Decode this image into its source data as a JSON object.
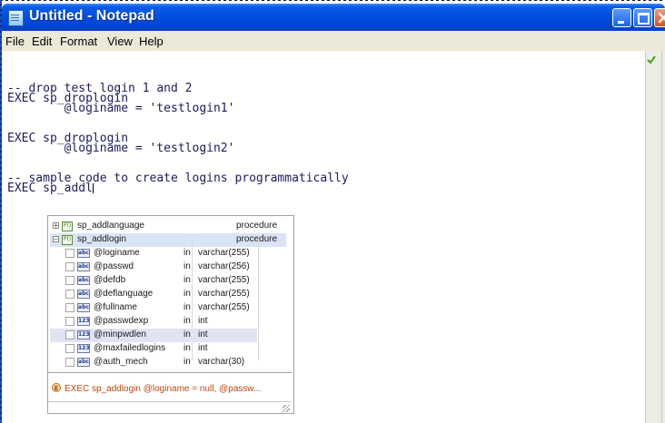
{
  "window": {
    "title": "Untitled - Notepad"
  },
  "menu": [
    "File",
    "Edit",
    "Format",
    "View",
    "Help"
  ],
  "editor": {
    "lines": [
      "",
      "-- drop test login 1 and 2",
      "EXEC sp_droplogin",
      "        @loginame = 'testlogin1'",
      "",
      "",
      "EXEC sp_droplogin",
      "        @loginame = 'testlogin2'",
      "",
      "",
      "-- sample code to create logins programmatically",
      "EXEC sp_addl"
    ]
  },
  "intellisense": {
    "items": [
      {
        "name": "sp_addlanguage",
        "kind": "procedure",
        "expander": "+",
        "icon": "P()"
      },
      {
        "name": "sp_addlogin",
        "kind": "procedure",
        "expander": "−",
        "icon": "P()"
      }
    ],
    "params": [
      {
        "type_icon": "abc",
        "name": "@loginame",
        "dir": "in",
        "type": "varchar(255)"
      },
      {
        "type_icon": "abc",
        "name": "@passwd",
        "dir": "in",
        "type": "varchar(256)"
      },
      {
        "type_icon": "abc",
        "name": "@defdb",
        "dir": "in",
        "type": "varchar(255)"
      },
      {
        "type_icon": "abc",
        "name": "@deflanguage",
        "dir": "in",
        "type": "varchar(255)"
      },
      {
        "type_icon": "abc",
        "name": "@fullname",
        "dir": "in",
        "type": "varchar(255)"
      },
      {
        "type_icon": "123",
        "name": "@passwdexp",
        "dir": "in",
        "type": "int"
      },
      {
        "type_icon": "123",
        "name": "@minpwdlen",
        "dir": "in",
        "type": "int"
      },
      {
        "type_icon": "123",
        "name": "@maxfailedlogins",
        "dir": "in",
        "type": "int"
      },
      {
        "type_icon": "abc",
        "name": "@auth_mech",
        "dir": "in",
        "type": "varchar(30)"
      }
    ],
    "preview_icon": "E",
    "preview": "EXEC sp_addlogin @loginame = null, @passw..."
  }
}
